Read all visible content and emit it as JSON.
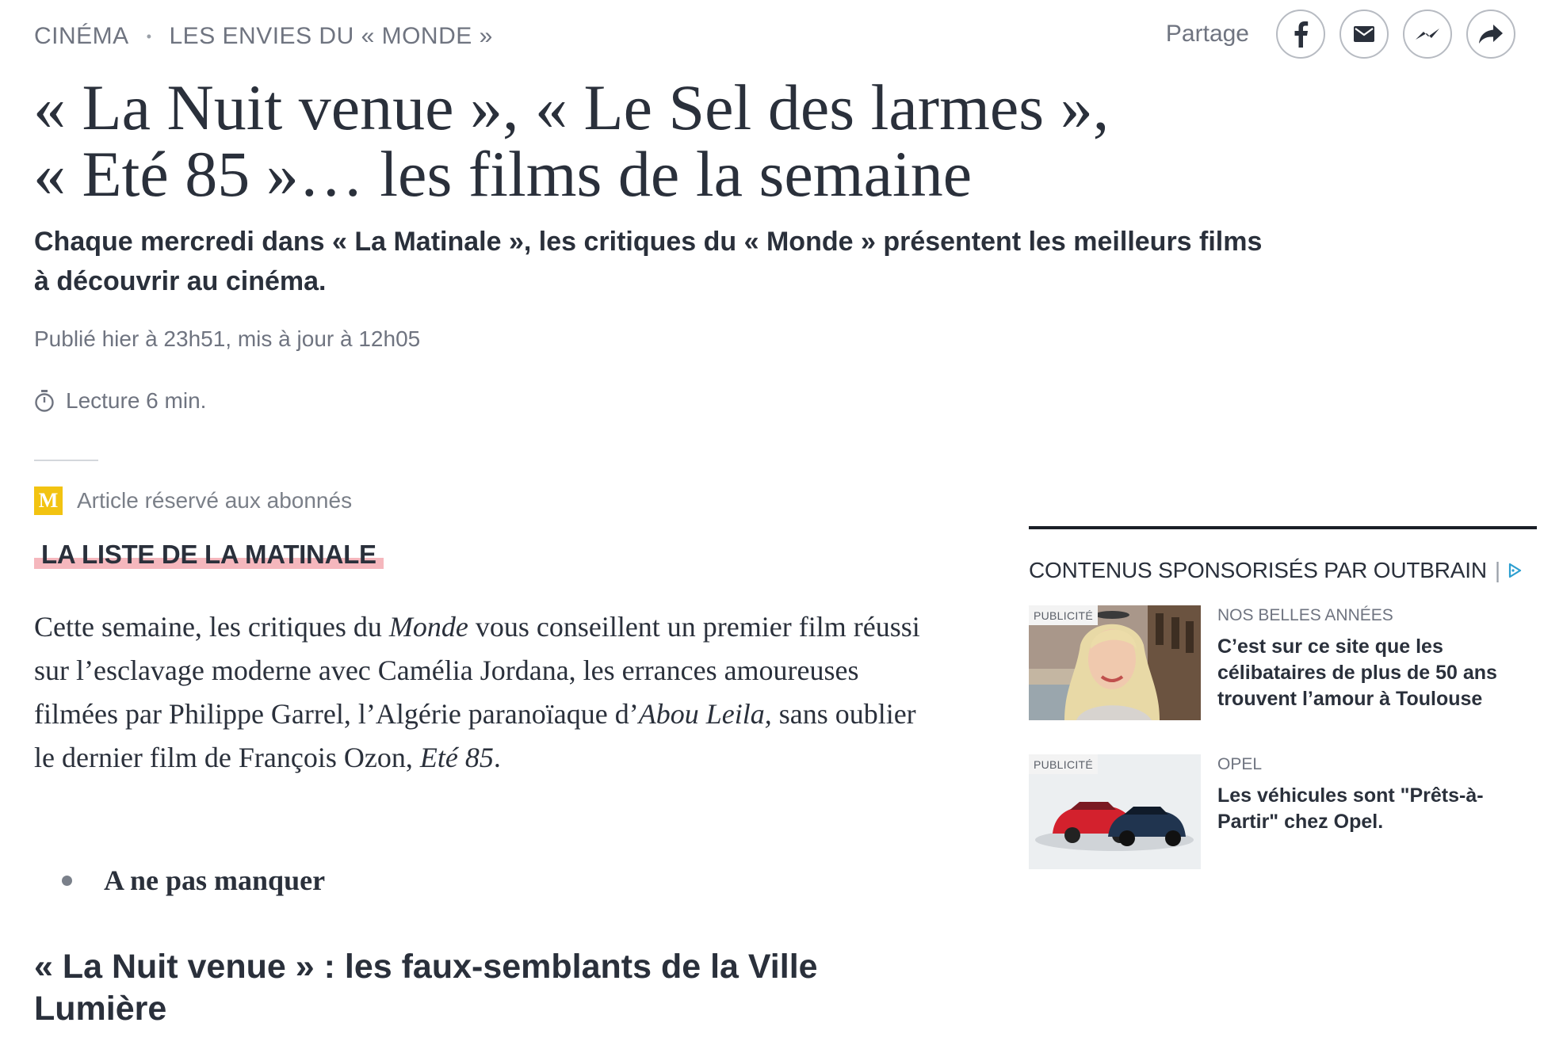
{
  "breadcrumb": {
    "section": "CINÉMA",
    "separator": "•",
    "subsection": "LES ENVIES DU « MONDE »"
  },
  "share": {
    "label": "Partage",
    "buttons": [
      {
        "icon": "facebook-icon"
      },
      {
        "icon": "email-icon"
      },
      {
        "icon": "messenger-icon"
      },
      {
        "icon": "share-arrow-icon"
      }
    ]
  },
  "article": {
    "title_line1": "« La Nuit venue », « Le Sel des larmes »,",
    "title_line2": "« Eté 85 »… les films de la semaine",
    "standfirst_line1": "Chaque mercredi dans « La Matinale », les critiques du « Monde » présentent les meilleurs films",
    "standfirst_line2": "à découvrir au cinéma.",
    "published": "Publié hier à 23h51, mis à jour à 12h05",
    "reading_time": "Lecture 6 min.",
    "premium_badge_letter": "M",
    "premium_label": "Article réservé aux abonnés",
    "kicker": "LA LISTE DE LA MATINALE",
    "intro": {
      "p1": "Cette semaine, les critiques du ",
      "monde": "Monde",
      "p2": " vous conseillent un premier film réussi sur l’esclavage moderne avec Camélia Jordana, les errances amoureuses filmées par Philippe Garrel, l’Algérie paranoïaque d’",
      "abou": "Abou Leila,",
      "p3": " sans oublier le dernier film de François Ozon, ",
      "ete": "Eté 85",
      "p4": "."
    },
    "bullet": "A ne pas manquer",
    "subheading": "« La Nuit venue » : les faux-semblants de la Ville Lumière"
  },
  "sidebar": {
    "outbrain_heading": "CONTENUS SPONSORISÉS PAR  OUTBRAIN",
    "outbrain_pipe": "|",
    "ads": [
      {
        "tag": "PUBLICITÉ",
        "brand": "NOS BELLES ANNÉES",
        "title": "C’est sur ce site que les célibataires de plus de 50 ans trouvent l’amour à Toulouse"
      },
      {
        "tag": "PUBLICITÉ",
        "brand": "OPEL",
        "title": "Les véhicules sont \"Prêts-à-Partir\" chez Opel."
      }
    ]
  },
  "colors": {
    "text": "#2a303b",
    "muted": "#6f7480",
    "premium_yellow": "#f2c311",
    "kicker_highlight": "#f5b7bd",
    "outbrain_blue": "#2b9ed0"
  }
}
